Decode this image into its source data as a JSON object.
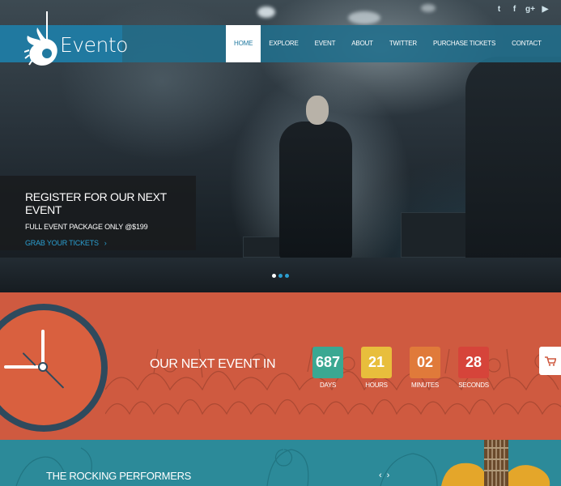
{
  "brand": {
    "name": "Evento"
  },
  "social": [
    {
      "name": "twitter-icon",
      "glyph": "t"
    },
    {
      "name": "facebook-icon",
      "glyph": "f"
    },
    {
      "name": "google-plus-icon",
      "glyph": "g+"
    },
    {
      "name": "youtube-icon",
      "glyph": "▶"
    }
  ],
  "nav": {
    "items": [
      "HOME",
      "EXPLORE",
      "EVENT",
      "ABOUT",
      "TWITTER",
      "PURCHASE TICKETS",
      "CONTACT"
    ],
    "active": "HOME"
  },
  "promo": {
    "title": "REGISTER FOR OUR NEXT EVENT",
    "subtitle": "FULL EVENT PACKAGE ONLY @$199",
    "link": "GRAB YOUR TICKETS",
    "link_arrow": "›"
  },
  "slider": {
    "count": 3,
    "active": 1
  },
  "countdown": {
    "title": "OUR NEXT EVENT IN",
    "days": {
      "value": "687",
      "label": "DAYS",
      "color": "#3aa892"
    },
    "hours": {
      "value": "21",
      "label": "HOURS",
      "color": "#e8be3c"
    },
    "minutes": {
      "value": "02",
      "label": "MINUTES",
      "color": "#e07a3a"
    },
    "seconds": {
      "value": "28",
      "label": "SECONDS",
      "color": "#d6443a"
    }
  },
  "performers": {
    "title": "THE ROCKING PERFORMERS",
    "prev": "‹",
    "next": "›"
  },
  "colors": {
    "nav_bg": "#2079a0",
    "countdown_bg": "#cf5a40",
    "performers_bg": "#2c8a99",
    "link": "#2b9ed0"
  }
}
